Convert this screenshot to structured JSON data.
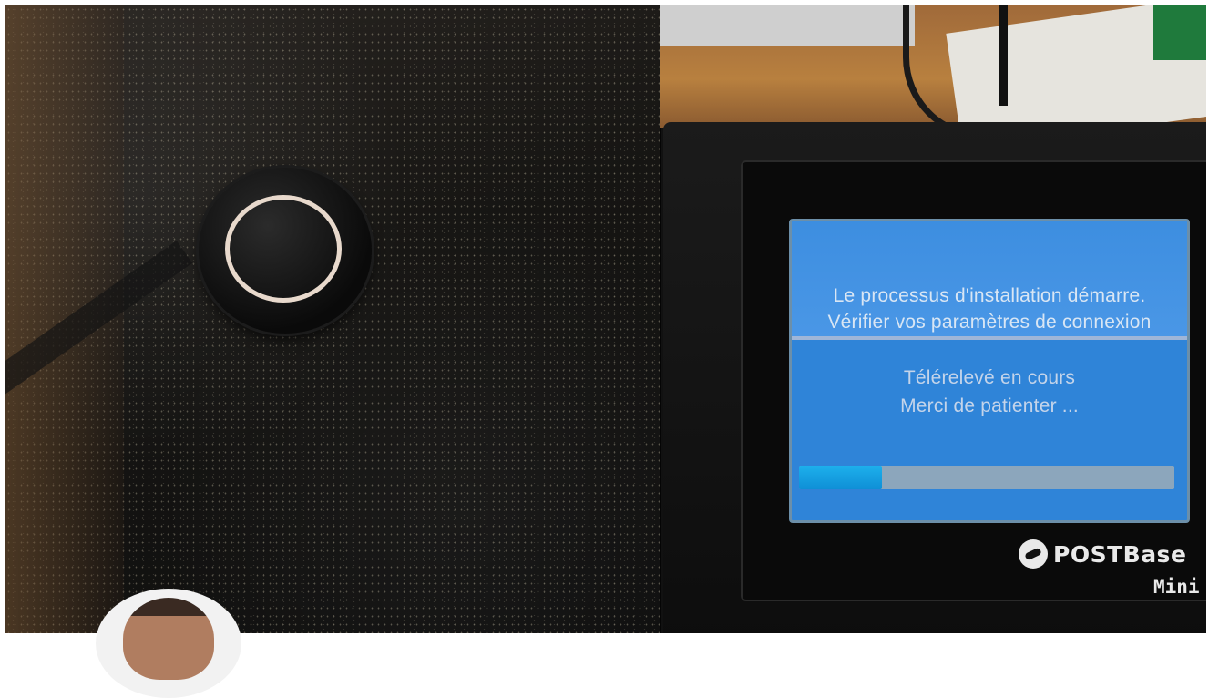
{
  "device": {
    "screen": {
      "header_line1": "Le processus d'installation démarre.",
      "header_line2": "Vérifier vos paramètres de connexion",
      "status_line1": "Télérelevé en cours",
      "status_line2": "Merci de patienter ...",
      "progress": 0.22
    },
    "brand": {
      "name": "POSTBase",
      "model": "Mini"
    }
  },
  "colors": {
    "screen_bg": "#2f84d8",
    "progress_fill": "#1db0ec",
    "device_body": "#111111"
  },
  "icons": [
    "power-icon",
    "postbase-logo-icon"
  ]
}
